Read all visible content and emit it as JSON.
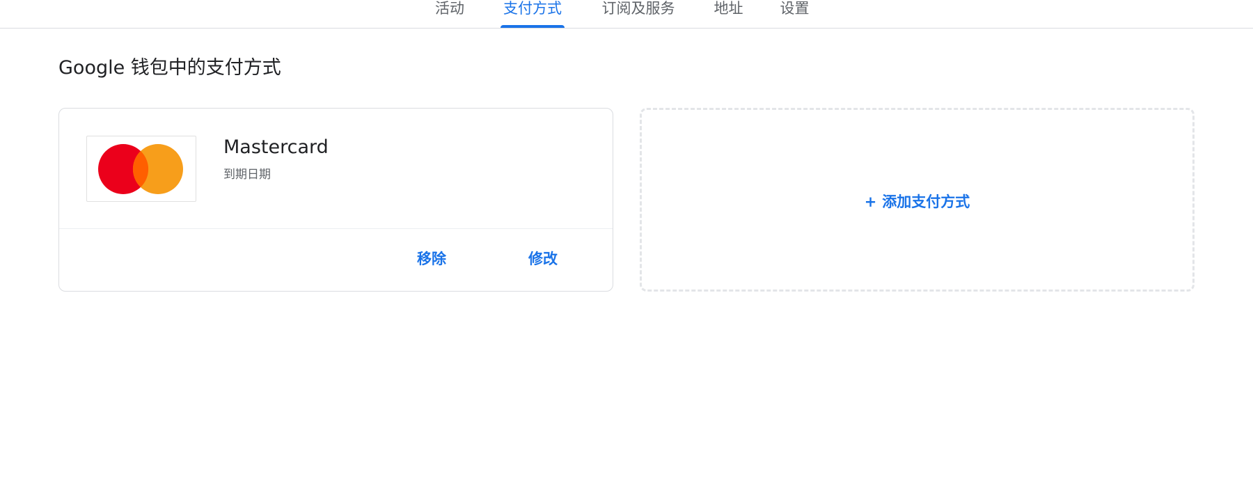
{
  "tabs": [
    {
      "label": "活动",
      "active": false
    },
    {
      "label": "支付方式",
      "active": true
    },
    {
      "label": "订阅及服务",
      "active": false
    },
    {
      "label": "地址",
      "active": false
    },
    {
      "label": "设置",
      "active": false
    }
  ],
  "section": {
    "title": "Google 钱包中的支付方式"
  },
  "payment_card": {
    "logo_icon": "mastercard-logo",
    "name": "Mastercard",
    "expiry_label": "到期日期",
    "remove_label": "移除",
    "edit_label": "修改"
  },
  "add_payment": {
    "plus_icon": "+",
    "label": "添加支付方式"
  },
  "colors": {
    "accent": "#1a73e8",
    "mastercard_red": "#eb001b",
    "mastercard_orange": "#f79e1b",
    "mastercard_overlap": "#ff5f00"
  }
}
